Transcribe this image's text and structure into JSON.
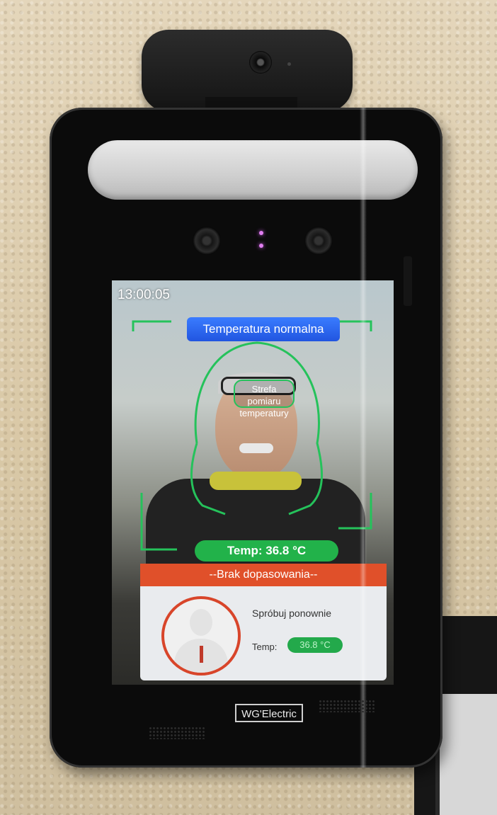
{
  "screen": {
    "clock": "13:00:05",
    "status_banner": "Temperatura normalna",
    "measurement_zone": {
      "line1": "Strefa pomiaru",
      "line2": "temperatury"
    },
    "temperature_pill": "Temp: 36.8 °C",
    "no_match_banner": "--Brak dopasowania--",
    "result_card": {
      "retry_text": "Spróbuj ponownie",
      "temp_label": "Temp:",
      "temp_value": "36.8 °C"
    }
  },
  "device": {
    "brand": "WG'Electric"
  },
  "colors": {
    "status_banner": "#2f6bf2",
    "face_outline": "#25c25b",
    "temperature_pill": "#22b24a",
    "no_match_banner": "#e0502a",
    "avatar_ring": "#d8452a"
  }
}
